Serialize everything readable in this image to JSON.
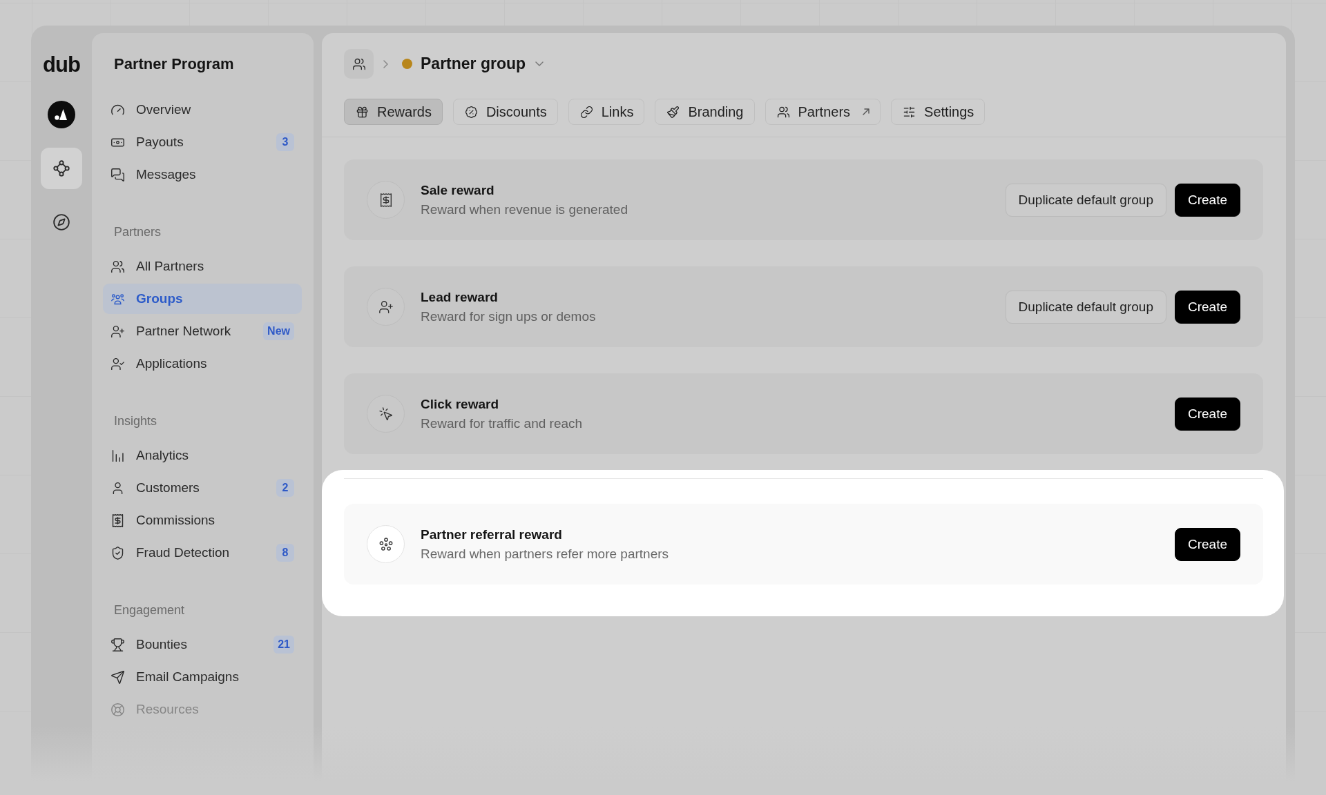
{
  "rail": {
    "logo": "dub",
    "items": [
      {
        "selected": true
      },
      {
        "selected": false
      }
    ]
  },
  "sidebar": {
    "title": "Partner Program",
    "sections": [
      {
        "items": [
          {
            "label": "Overview",
            "selected": false,
            "faded": false
          },
          {
            "label": "Payouts",
            "selected": false,
            "faded": false,
            "badge": "3"
          },
          {
            "label": "Messages",
            "selected": false,
            "faded": false
          }
        ]
      },
      {
        "heading": "Partners",
        "items": [
          {
            "label": "All Partners",
            "selected": false,
            "faded": false
          },
          {
            "label": "Groups",
            "selected": true,
            "faded": false
          },
          {
            "label": "Partner Network",
            "selected": false,
            "faded": false,
            "badge": "New"
          },
          {
            "label": "Applications",
            "selected": false,
            "faded": false
          }
        ]
      },
      {
        "heading": "Insights",
        "items": [
          {
            "label": "Analytics",
            "selected": false,
            "faded": false
          },
          {
            "label": "Customers",
            "selected": false,
            "faded": false,
            "badge": "2"
          },
          {
            "label": "Commissions",
            "selected": false,
            "faded": false
          },
          {
            "label": "Fraud Detection",
            "selected": false,
            "faded": false,
            "badge": "8"
          }
        ]
      },
      {
        "heading": "Engagement",
        "items": [
          {
            "label": "Bounties",
            "selected": false,
            "faded": false,
            "badge": "21"
          },
          {
            "label": "Email Campaigns",
            "selected": false,
            "faded": false
          },
          {
            "label": "Resources",
            "selected": false,
            "faded": true
          }
        ]
      }
    ]
  },
  "header": {
    "title": "Partner group"
  },
  "tabs": [
    {
      "label": "Rewards",
      "selected": true,
      "external": false
    },
    {
      "label": "Discounts",
      "selected": false,
      "external": false
    },
    {
      "label": "Links",
      "selected": false,
      "external": false
    },
    {
      "label": "Branding",
      "selected": false,
      "external": false
    },
    {
      "label": "Partners",
      "selected": false,
      "external": true
    },
    {
      "label": "Settings",
      "selected": false,
      "external": false
    }
  ],
  "rewards": [
    {
      "title": "Sale reward",
      "description": "Reward when revenue is generated",
      "highlighted": false,
      "actions": [
        {
          "label": "Duplicate default group",
          "kind": "secondary"
        },
        {
          "label": "Create",
          "kind": "primary"
        }
      ]
    },
    {
      "title": "Lead reward",
      "description": "Reward for sign ups or demos",
      "highlighted": false,
      "actions": [
        {
          "label": "Duplicate default group",
          "kind": "secondary"
        },
        {
          "label": "Create",
          "kind": "primary"
        }
      ]
    },
    {
      "title": "Click reward",
      "description": "Reward for traffic and reach",
      "highlighted": false,
      "actions": [
        {
          "label": "Create",
          "kind": "primary"
        }
      ]
    },
    {
      "title": "Partner referral reward",
      "description": "Reward when partners refer more partners",
      "highlighted": true,
      "actions": [
        {
          "label": "Create",
          "kind": "primary"
        }
      ]
    }
  ]
}
